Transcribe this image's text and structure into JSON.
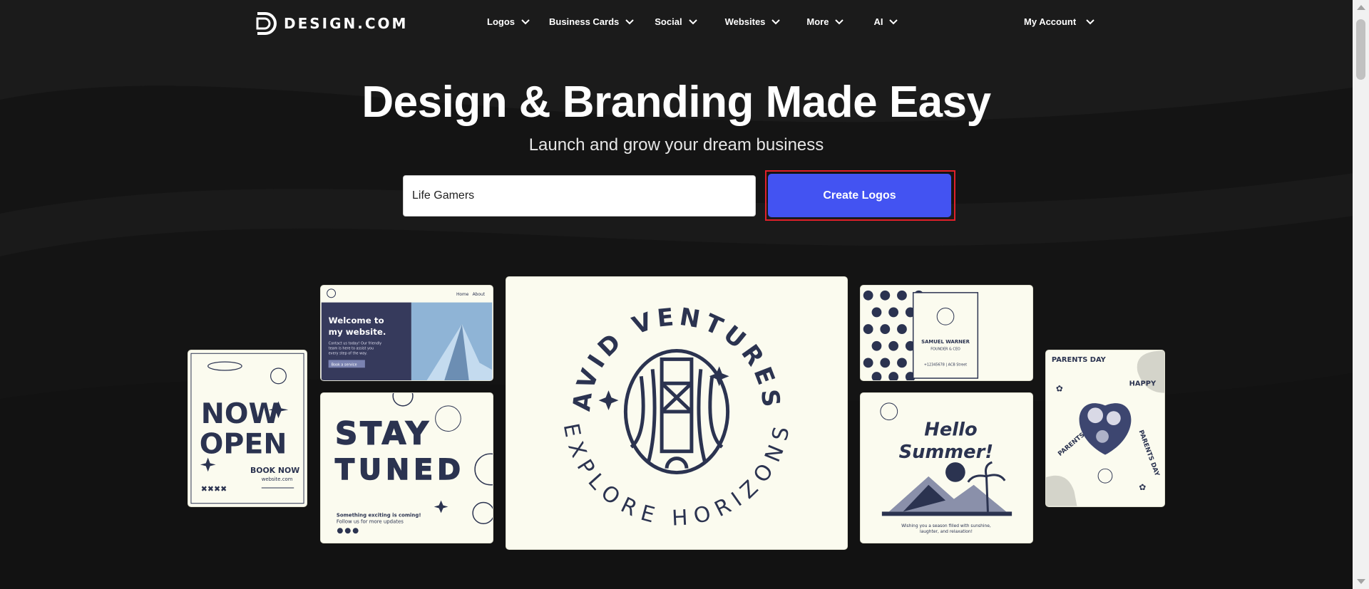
{
  "brand": {
    "name": "DESIGN.COM",
    "icon": "design-logo-icon"
  },
  "nav": {
    "items": [
      {
        "label": "Logos"
      },
      {
        "label": "Business Cards"
      },
      {
        "label": "Social"
      },
      {
        "label": "Websites"
      },
      {
        "label": "More"
      },
      {
        "label": "AI"
      }
    ],
    "account": "My Account"
  },
  "hero": {
    "title": "Design & Branding Made Easy",
    "subtitle": "Launch and grow your dream business",
    "input_value": "Life Gamers",
    "cta_label": "Create Logos"
  },
  "colors": {
    "background": "#141414",
    "accent": "#4353f2",
    "card": "#fbfbef",
    "ink": "#2b3350",
    "highlight": "#e0202a"
  },
  "cards": {
    "now_open": {
      "line1": "NOW",
      "line2": "OPEN",
      "cta": "BOOK NOW",
      "site": "website.com",
      "marks": "✖✖✖✖"
    },
    "website": {
      "nav1": "Home",
      "nav2": "About",
      "title1": "Welcome to",
      "title2": "my website.",
      "body1": "Contact us today! Our friendly",
      "body2": "team is here to assist you",
      "body3": "every step of the way.",
      "button": "Book a service"
    },
    "stay_tuned": {
      "word1": "STAY",
      "word2": "TUNED",
      "line1": "Something exciting is coming!",
      "line2": "Follow us for more updates"
    },
    "avid": {
      "top": "AVID VENTURES",
      "bottom": "EXPLORE HORIZONS"
    },
    "business_card": {
      "name": "SAMUEL WARNER",
      "role": "FOUNDER & CEO",
      "contact": "+12345678 | ACB Street"
    },
    "summer": {
      "title1": "Hello",
      "title2": "Summer!",
      "line1": "Wishing you a season filled with sunshine,",
      "line2": "laughter, and relaxation!"
    },
    "parents": {
      "arc1": "PARENTS DAY",
      "arc2": "HAPPY",
      "arc3": "PARENTS DAY",
      "arc4": "PARENTS DAY"
    }
  }
}
